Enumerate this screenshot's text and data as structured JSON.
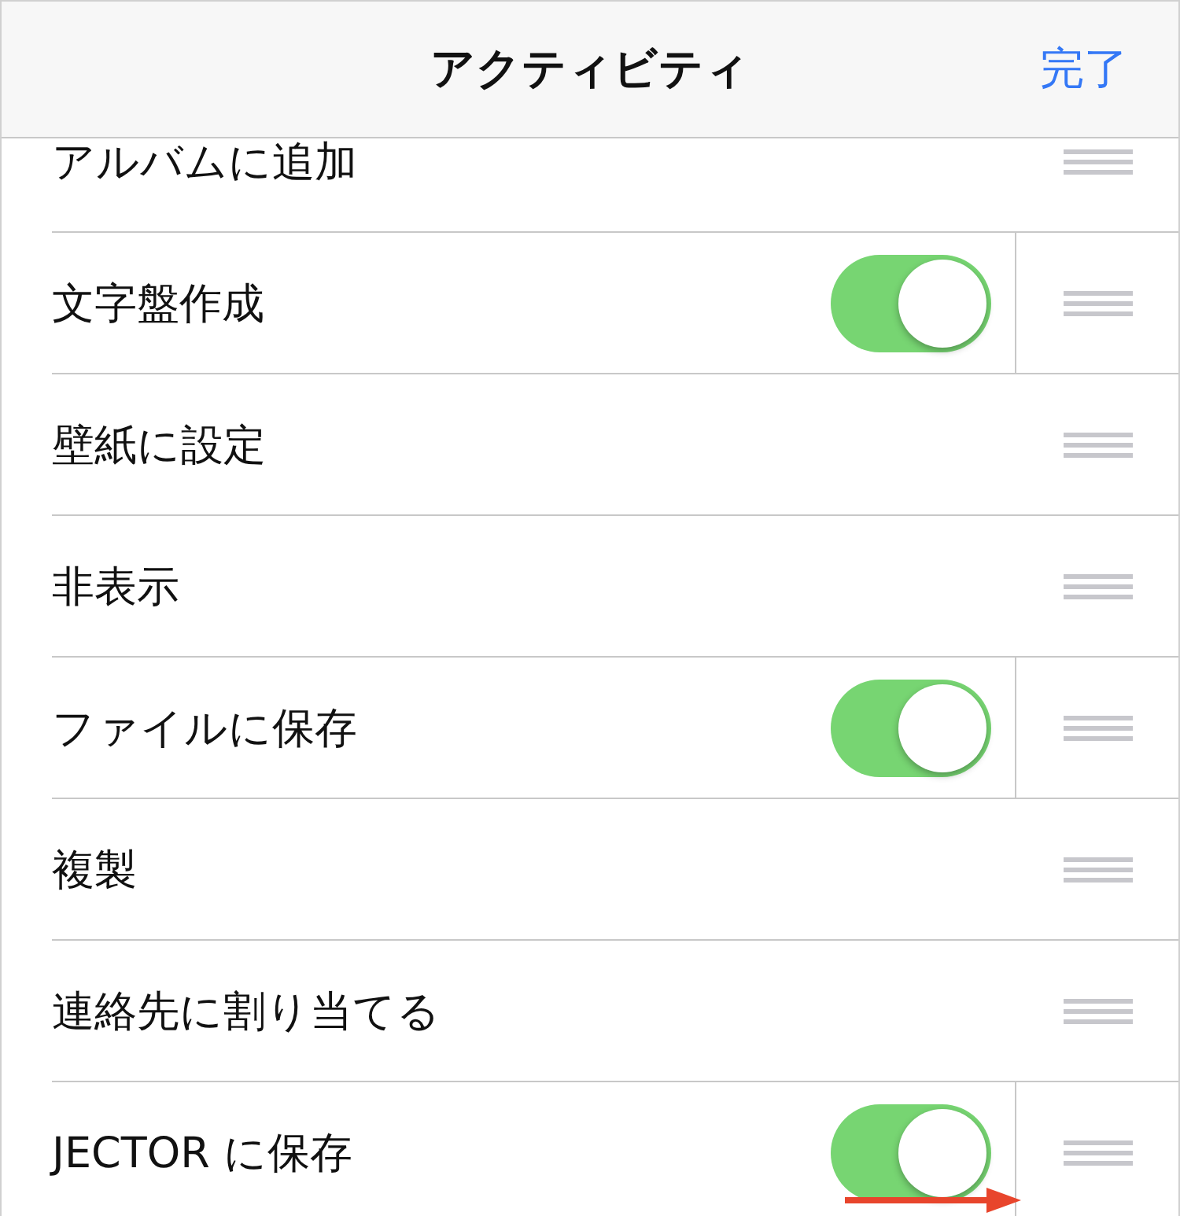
{
  "nav_bar": {
    "title": "アクティビティ",
    "done_button": "完了"
  },
  "rows": [
    {
      "label": "アルバムに追加",
      "kind": "plain"
    },
    {
      "label": "文字盤作成",
      "kind": "toggle",
      "on": true
    },
    {
      "label": "壁紙に設定",
      "kind": "plain"
    },
    {
      "label": "非表示",
      "kind": "plain"
    },
    {
      "label": "ファイルに保存",
      "kind": "toggle",
      "on": true
    },
    {
      "label": "複製",
      "kind": "plain"
    },
    {
      "label": "連絡先に割り当てる",
      "kind": "plain"
    },
    {
      "label": "JECTOR に保存",
      "kind": "toggle",
      "on": true
    }
  ]
}
